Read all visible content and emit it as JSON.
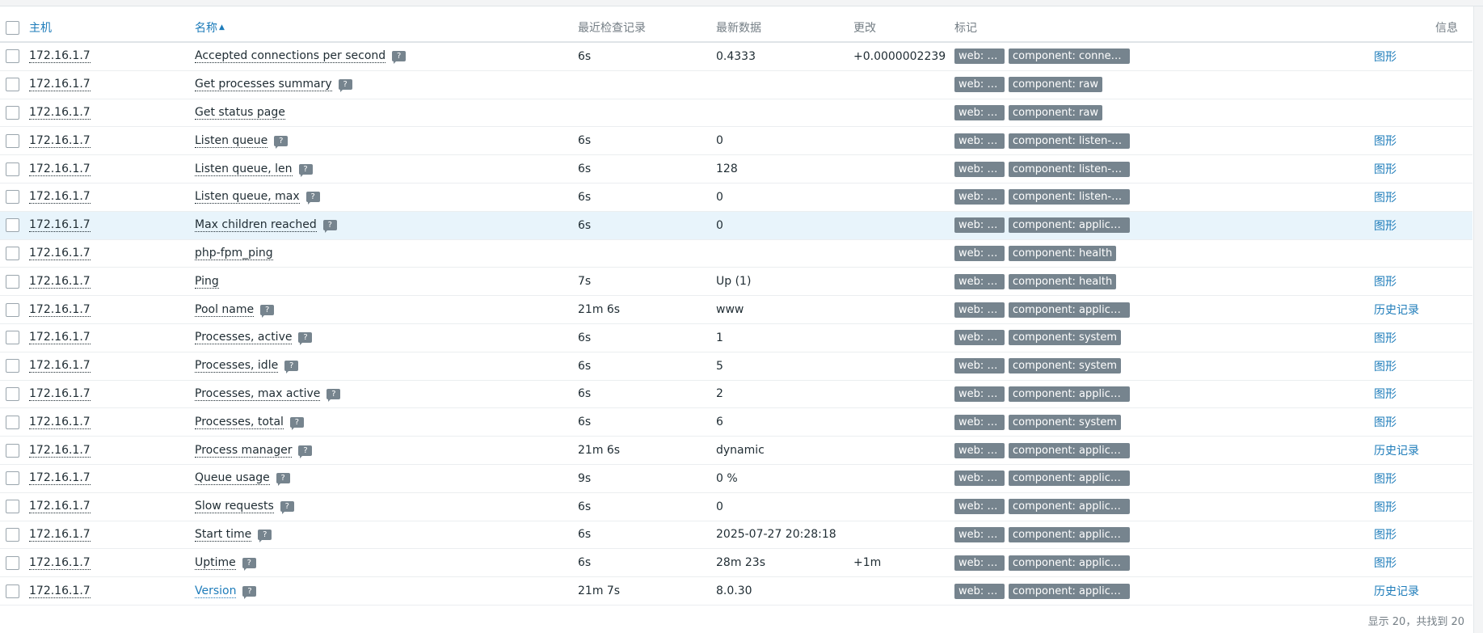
{
  "columns": {
    "host": "主机",
    "name": "名称",
    "last_check": "最近检查记录",
    "latest_data": "最新数据",
    "change": "更改",
    "tags": "标记",
    "info": "信息"
  },
  "rows": [
    {
      "host": "172.16.1.7",
      "name": "Accepted connections per second",
      "hint": "?",
      "last_check": "6s",
      "latest": "0.4333",
      "change": "+0.0000002239",
      "tags": [
        "web: php",
        "component: connecti..."
      ],
      "link": "图形"
    },
    {
      "host": "172.16.1.7",
      "name": "Get processes summary",
      "hint": "?",
      "last_check": "",
      "latest": "",
      "change": "",
      "tags": [
        "web: php",
        "component: raw"
      ],
      "link": ""
    },
    {
      "host": "172.16.1.7",
      "name": "Get status page",
      "hint": "",
      "last_check": "",
      "latest": "",
      "change": "",
      "tags": [
        "web: php",
        "component: raw"
      ],
      "link": ""
    },
    {
      "host": "172.16.1.7",
      "name": "Listen queue",
      "hint": "?",
      "last_check": "6s",
      "latest": "0",
      "change": "",
      "tags": [
        "web: php",
        "component: listen-qu..."
      ],
      "link": "图形"
    },
    {
      "host": "172.16.1.7",
      "name": "Listen queue, len",
      "hint": "?",
      "last_check": "6s",
      "latest": "128",
      "change": "",
      "tags": [
        "web: php",
        "component: listen-qu..."
      ],
      "link": "图形"
    },
    {
      "host": "172.16.1.7",
      "name": "Listen queue, max",
      "hint": "?",
      "last_check": "6s",
      "latest": "0",
      "change": "",
      "tags": [
        "web: php",
        "component: listen-qu..."
      ],
      "link": "图形"
    },
    {
      "host": "172.16.1.7",
      "name": "Max children reached",
      "hint": "?",
      "last_check": "6s",
      "latest": "0",
      "change": "",
      "tags": [
        "web: php",
        "component: application"
      ],
      "link": "图形"
    },
    {
      "host": "172.16.1.7",
      "name": "php-fpm_ping",
      "hint": "",
      "last_check": "",
      "latest": "",
      "change": "",
      "tags": [
        "web: php",
        "component: health"
      ],
      "link": ""
    },
    {
      "host": "172.16.1.7",
      "name": "Ping",
      "hint": "",
      "last_check": "7s",
      "latest": "Up (1)",
      "change": "",
      "tags": [
        "web: php",
        "component: health"
      ],
      "link": "图形"
    },
    {
      "host": "172.16.1.7",
      "name": "Pool name",
      "hint": "?",
      "last_check": "21m 6s",
      "latest": "www",
      "change": "",
      "tags": [
        "web: php",
        "component: application"
      ],
      "link": "历史记录"
    },
    {
      "host": "172.16.1.7",
      "name": "Processes, active",
      "hint": "?",
      "last_check": "6s",
      "latest": "1",
      "change": "",
      "tags": [
        "web: php",
        "component: system"
      ],
      "link": "图形"
    },
    {
      "host": "172.16.1.7",
      "name": "Processes, idle",
      "hint": "?",
      "last_check": "6s",
      "latest": "5",
      "change": "",
      "tags": [
        "web: php",
        "component: system"
      ],
      "link": "图形"
    },
    {
      "host": "172.16.1.7",
      "name": "Processes, max active",
      "hint": "?",
      "last_check": "6s",
      "latest": "2",
      "change": "",
      "tags": [
        "web: php",
        "component: application"
      ],
      "link": "图形"
    },
    {
      "host": "172.16.1.7",
      "name": "Processes, total",
      "hint": "?",
      "last_check": "6s",
      "latest": "6",
      "change": "",
      "tags": [
        "web: php",
        "component: system"
      ],
      "link": "图形"
    },
    {
      "host": "172.16.1.7",
      "name": "Process manager",
      "hint": "?",
      "last_check": "21m 6s",
      "latest": "dynamic",
      "change": "",
      "tags": [
        "web: php",
        "component: application"
      ],
      "link": "历史记录"
    },
    {
      "host": "172.16.1.7",
      "name": "Queue usage",
      "hint": "?",
      "last_check": "9s",
      "latest": "0 %",
      "change": "",
      "tags": [
        "web: php",
        "component: application"
      ],
      "link": "图形"
    },
    {
      "host": "172.16.1.7",
      "name": "Slow requests",
      "hint": "?",
      "last_check": "6s",
      "latest": "0",
      "change": "",
      "tags": [
        "web: php",
        "component: application"
      ],
      "link": "图形"
    },
    {
      "host": "172.16.1.7",
      "name": "Start time",
      "hint": "?",
      "last_check": "6s",
      "latest": "2025-07-27 20:28:18",
      "change": "",
      "tags": [
        "web: php",
        "component: application"
      ],
      "link": "图形"
    },
    {
      "host": "172.16.1.7",
      "name": "Uptime",
      "hint": "?",
      "last_check": "6s",
      "latest": "28m 23s",
      "change": "+1m",
      "tags": [
        "web: php",
        "component: application"
      ],
      "link": "图形"
    },
    {
      "host": "172.16.1.7",
      "name": "Version",
      "hint": "?",
      "last_check": "21m 7s",
      "latest": "8.0.30",
      "change": "",
      "tags": [
        "web: php",
        "component: application"
      ],
      "link": "历史记录",
      "name_is_link": true
    }
  ],
  "highlighted_row": 6,
  "footer": "显示 20，共找到 20",
  "colors": {
    "link": "#1e7cba",
    "tag_bg": "#76848e",
    "row_highlight": "#e8f4fb"
  }
}
